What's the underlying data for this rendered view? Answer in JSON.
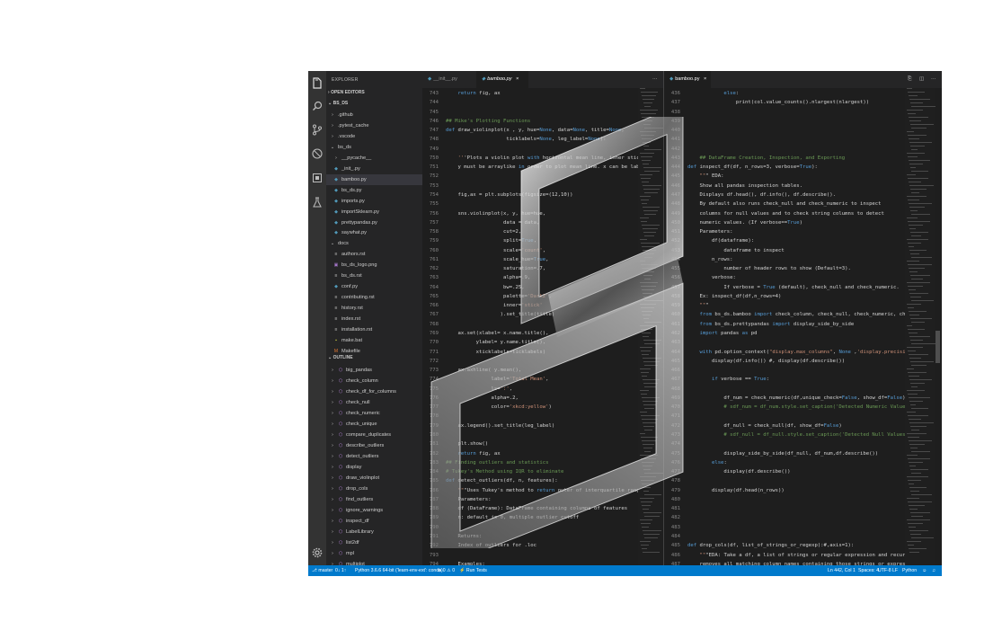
{
  "activity_bar": {
    "icons": [
      "files-icon",
      "search-icon",
      "source-control-icon",
      "debug-icon",
      "extensions-icon",
      "beaker-icon",
      "gear-icon"
    ]
  },
  "sidebar": {
    "title": "EXPLORER",
    "open_editors": "OPEN EDITORS",
    "root": "BS_DS",
    "files": [
      {
        "label": ".github",
        "icon": "chevron-right",
        "indent": 1
      },
      {
        "label": ".pytest_cache",
        "icon": "chevron-right",
        "indent": 1
      },
      {
        "label": ".vscode",
        "icon": "chevron-right",
        "indent": 1
      },
      {
        "label": "bs_ds",
        "icon": "chevron-down",
        "indent": 1
      },
      {
        "label": "__pycache__",
        "icon": "chevron-right",
        "indent": 2
      },
      {
        "label": "_init_.py",
        "icon": "python",
        "indent": 2
      },
      {
        "label": "bamboo.py",
        "icon": "python",
        "indent": 2,
        "selected": true
      },
      {
        "label": "bs_ds.py",
        "icon": "python",
        "indent": 2
      },
      {
        "label": "imports.py",
        "icon": "python",
        "indent": 2
      },
      {
        "label": "importSklearn.py",
        "icon": "python",
        "indent": 2
      },
      {
        "label": "prettypandas.py",
        "icon": "python",
        "indent": 2
      },
      {
        "label": "saywhat.py",
        "icon": "python",
        "indent": 2
      },
      {
        "label": "docs",
        "icon": "chevron-down",
        "indent": 1
      },
      {
        "label": "authors.rst",
        "icon": "text",
        "indent": 2
      },
      {
        "label": "bs_ds_logo.png",
        "icon": "image",
        "indent": 2
      },
      {
        "label": "bs_ds.rst",
        "icon": "text",
        "indent": 2
      },
      {
        "label": "conf.py",
        "icon": "python",
        "indent": 2
      },
      {
        "label": "contributing.rst",
        "icon": "text",
        "indent": 2
      },
      {
        "label": "history.rst",
        "icon": "text",
        "indent": 2
      },
      {
        "label": "index.rst",
        "icon": "text",
        "indent": 2
      },
      {
        "label": "installation.rst",
        "icon": "text",
        "indent": 2
      },
      {
        "label": "make.bat",
        "icon": "bat",
        "indent": 2
      },
      {
        "label": "Makefile",
        "icon": "makefile",
        "indent": 2
      }
    ],
    "outline_title": "OUTLINE",
    "outline": [
      "big_pandas",
      "check_column",
      "check_df_for_columns",
      "check_null",
      "check_numeric",
      "check_unique",
      "compare_duplicates",
      "describe_outliers",
      "detect_outliers",
      "display",
      "draw_violinplot",
      "drop_cols",
      "find_outliers",
      "ignore_warnings",
      "inspect_df",
      "LabelLibrary",
      "list2df",
      "mpl",
      "multiplot"
    ]
  },
  "tabs_left": [
    {
      "label": "__init__.py",
      "active": false
    },
    {
      "label": "bamboo.py",
      "active": true,
      "close": "×"
    }
  ],
  "tabs_right": [
    {
      "label": "bamboo.py",
      "active": true,
      "close": "×"
    }
  ],
  "left_editor": {
    "lines": [
      {
        "n": "743",
        "t": "    return fig, ax"
      },
      {
        "n": "744",
        "t": ""
      },
      {
        "n": "745",
        "t": ""
      },
      {
        "n": "746",
        "t": "## Mike's Plotting Functions"
      },
      {
        "n": "747",
        "t": "def draw_violinplot(x , y, hue=None, data=None, title=None,"
      },
      {
        "n": "748",
        "t": "                    ticklabels=None, leg_label=None):"
      },
      {
        "n": "749",
        "t": ""
      },
      {
        "n": "750",
        "t": "    '''Plots a violin plot with horizontal mean line, inner stick lines"
      },
      {
        "n": "751",
        "t": "    y must be arraylike in order to plot mean line. x can be label in d"
      },
      {
        "n": "752",
        "t": ""
      },
      {
        "n": "753",
        "t": ""
      },
      {
        "n": "754",
        "t": "    fig,ax = plt.subplots(figsize=(12,10))"
      },
      {
        "n": "755",
        "t": ""
      },
      {
        "n": "756",
        "t": "    sns.violinplot(x, y, hue=hue,"
      },
      {
        "n": "757",
        "t": "                   data = data,"
      },
      {
        "n": "758",
        "t": "                   cut=2,"
      },
      {
        "n": "759",
        "t": "                   split=True,"
      },
      {
        "n": "760",
        "t": "                   scale='count',"
      },
      {
        "n": "761",
        "t": "                   scale_hue=True,"
      },
      {
        "n": "762",
        "t": "                   saturation=.7,"
      },
      {
        "n": "763",
        "t": "                   alpha=.9,"
      },
      {
        "n": "764",
        "t": "                   bw=.25,"
      },
      {
        "n": "765",
        "t": "                   palette='Dark2',"
      },
      {
        "n": "766",
        "t": "                   inner='stick'"
      },
      {
        "n": "767",
        "t": "                  ).set_title(title)"
      },
      {
        "n": "768",
        "t": ""
      },
      {
        "n": "769",
        "t": "    ax.set(xlabel= x.name.title(),"
      },
      {
        "n": "770",
        "t": "          ylabel= y.name.title(),"
      },
      {
        "n": "771",
        "t": "          xticklabels=ticklabels)"
      },
      {
        "n": "772",
        "t": ""
      },
      {
        "n": "773",
        "t": "    ax.axhline( y.mean(),"
      },
      {
        "n": "774",
        "t": "               label='Total Mean',"
      },
      {
        "n": "775",
        "t": "               ls=':',"
      },
      {
        "n": "776",
        "t": "               alpha=.2,"
      },
      {
        "n": "777",
        "t": "               color='xkcd:yellow')"
      },
      {
        "n": "778",
        "t": ""
      },
      {
        "n": "779",
        "t": "    ax.legend().set_title(leg_label)"
      },
      {
        "n": "780",
        "t": ""
      },
      {
        "n": "781",
        "t": "    plt.show()"
      },
      {
        "n": "782",
        "t": "    return fig, ax"
      },
      {
        "n": "783",
        "t": "## Finding outliers and statistics"
      },
      {
        "n": "784",
        "t": "# Tukey's Method using IQR to eliminate"
      },
      {
        "n": "785",
        "t": "def detect_outliers(df, n, features):"
      },
      {
        "n": "786",
        "t": "    \"\"\"Uses Tukey's method to return outer of interquartile ranges to r"
      },
      {
        "n": "787",
        "t": "    Parameters:"
      },
      {
        "n": "788",
        "t": "    df (DataFrame): DataFrame containing columns of features"
      },
      {
        "n": "789",
        "t": "    n: default is 0, multiple outlier cutoff"
      },
      {
        "n": "790",
        "t": ""
      },
      {
        "n": "791",
        "t": "    Returns:"
      },
      {
        "n": "792",
        "t": "    Index of outliers for .loc"
      },
      {
        "n": "793",
        "t": ""
      },
      {
        "n": "794",
        "t": "    Examples:"
      }
    ]
  },
  "right_editor": {
    "lines": [
      {
        "n": "436",
        "t": "            else:"
      },
      {
        "n": "437",
        "t": "                print(col.value_counts().nlargest(nlargest))"
      },
      {
        "n": "438",
        "t": ""
      },
      {
        "n": "439",
        "t": ""
      },
      {
        "n": "440",
        "t": ""
      },
      {
        "n": "441",
        "t": ""
      },
      {
        "n": "442",
        "t": ""
      },
      {
        "n": "443",
        "t": "    ## DataFrame Creation, Inspection, and Exporting"
      },
      {
        "n": "444",
        "t": "def inspect_df(df, n_rows=3, verbose=True):"
      },
      {
        "n": "445",
        "t": "    \"\"\" EDA:"
      },
      {
        "n": "446",
        "t": "    Show all pandas inspection tables."
      },
      {
        "n": "447",
        "t": "    Displays df.head(), df.info(), df.describe()."
      },
      {
        "n": "448",
        "t": "    By default also runs check_null and check_numeric to inspect"
      },
      {
        "n": "449",
        "t": "    columns for null values and to check string columns to detect"
      },
      {
        "n": "450",
        "t": "    numeric values. (If verbose==True)"
      },
      {
        "n": "451",
        "t": "    Parameters:"
      },
      {
        "n": "452",
        "t": "        df(dataframe):"
      },
      {
        "n": "453",
        "t": "            dataframe to inspect"
      },
      {
        "n": "454",
        "t": "        n_rows:"
      },
      {
        "n": "455",
        "t": "            number of header rows to show (Default=3)."
      },
      {
        "n": "456",
        "t": "        verbose:"
      },
      {
        "n": "457",
        "t": "            If verbose = True (default), check_null and check_numeric."
      },
      {
        "n": "458",
        "t": "    Ex: inspect_df(df,n_rows=4)"
      },
      {
        "n": "459",
        "t": "    \"\"\""
      },
      {
        "n": "460",
        "t": "    from bs_ds.bamboo import check_column, check_null, check_numeric, check_unique"
      },
      {
        "n": "461",
        "t": "    from bs_ds.prettypandas import display_side_by_side"
      },
      {
        "n": "462",
        "t": "    import pandas as pd"
      },
      {
        "n": "463",
        "t": ""
      },
      {
        "n": "464",
        "t": "    with pd.option_context(\"display.max_columns\", None ,'display.precision',4):"
      },
      {
        "n": "465",
        "t": "        display(df.info()) #, display(df.describe())"
      },
      {
        "n": "466",
        "t": ""
      },
      {
        "n": "467",
        "t": "        if verbose == True:"
      },
      {
        "n": "468",
        "t": ""
      },
      {
        "n": "469",
        "t": "            df_num = check_numeric(df,unique_check=False, show_df=False)"
      },
      {
        "n": "470",
        "t": "            # sdf_num = df_num.style.set_caption('Detected Numeric Values')"
      },
      {
        "n": "471",
        "t": ""
      },
      {
        "n": "472",
        "t": "            df_null = check_null(df, show_df=False)"
      },
      {
        "n": "473",
        "t": "            # sdf_null = df_null.style.set_caption('Detected Null Values')"
      },
      {
        "n": "474",
        "t": ""
      },
      {
        "n": "475",
        "t": "            display_side_by_side(df_null, df_num,df.describe())"
      },
      {
        "n": "476",
        "t": "        else:"
      },
      {
        "n": "477",
        "t": "            display(df.describe())"
      },
      {
        "n": "478",
        "t": ""
      },
      {
        "n": "479",
        "t": "        display(df.head(n_rows))"
      },
      {
        "n": "480",
        "t": ""
      },
      {
        "n": "481",
        "t": ""
      },
      {
        "n": "482",
        "t": ""
      },
      {
        "n": "483",
        "t": ""
      },
      {
        "n": "484",
        "t": ""
      },
      {
        "n": "485",
        "t": "def drop_cols(df, list_of_strings_or_regexp):#,axis=1):"
      },
      {
        "n": "486",
        "t": "    \"\"\"EDA: Take a df, a list of strings or regular expression and recursively"
      },
      {
        "n": "487",
        "t": "    removes all matching column names containing those strings or expressions."
      },
      {
        "n": "488",
        "t": "    # Example: if the df_in columns are ['price','sqft','sqft_living','sqft15','sqft_"
      },
      {
        "n": "489",
        "t": "    df_out = drop_cols(df_in, ['sqft','bedroom'])"
      }
    ]
  },
  "statusbar": {
    "branch": "master",
    "sync": "0↓ 1↑",
    "interpreter": "Python 3.6.6 64-bit ('learn-env-ext': conda)",
    "problems": "⊗ 0  ⚠ 0",
    "run_tests": "⚡ Run Tests",
    "position": "Ln 442, Col 1",
    "spaces": "Spaces: 4",
    "encoding": "UTF-8",
    "eol": "LF",
    "language": "Python"
  },
  "colors": {
    "keyword": "#569cd6",
    "function": "#dcdcaa",
    "string": "#ce9178",
    "comment": "#6a9955",
    "number": "#b5cea8",
    "statusbar": "#007acc",
    "background": "#1e1e1e"
  }
}
